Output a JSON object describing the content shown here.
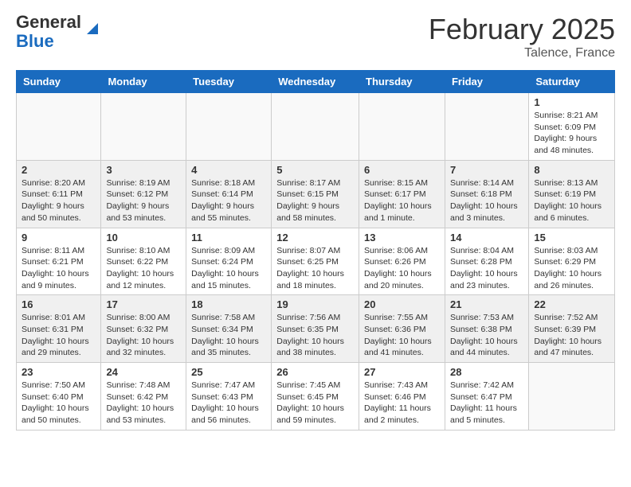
{
  "header": {
    "logo_general": "General",
    "logo_blue": "Blue",
    "month_title": "February 2025",
    "location": "Talence, France"
  },
  "weekdays": [
    "Sunday",
    "Monday",
    "Tuesday",
    "Wednesday",
    "Thursday",
    "Friday",
    "Saturday"
  ],
  "weeks": [
    [
      {
        "day": "",
        "info": ""
      },
      {
        "day": "",
        "info": ""
      },
      {
        "day": "",
        "info": ""
      },
      {
        "day": "",
        "info": ""
      },
      {
        "day": "",
        "info": ""
      },
      {
        "day": "",
        "info": ""
      },
      {
        "day": "1",
        "info": "Sunrise: 8:21 AM\nSunset: 6:09 PM\nDaylight: 9 hours and 48 minutes."
      }
    ],
    [
      {
        "day": "2",
        "info": "Sunrise: 8:20 AM\nSunset: 6:11 PM\nDaylight: 9 hours and 50 minutes."
      },
      {
        "day": "3",
        "info": "Sunrise: 8:19 AM\nSunset: 6:12 PM\nDaylight: 9 hours and 53 minutes."
      },
      {
        "day": "4",
        "info": "Sunrise: 8:18 AM\nSunset: 6:14 PM\nDaylight: 9 hours and 55 minutes."
      },
      {
        "day": "5",
        "info": "Sunrise: 8:17 AM\nSunset: 6:15 PM\nDaylight: 9 hours and 58 minutes."
      },
      {
        "day": "6",
        "info": "Sunrise: 8:15 AM\nSunset: 6:17 PM\nDaylight: 10 hours and 1 minute."
      },
      {
        "day": "7",
        "info": "Sunrise: 8:14 AM\nSunset: 6:18 PM\nDaylight: 10 hours and 3 minutes."
      },
      {
        "day": "8",
        "info": "Sunrise: 8:13 AM\nSunset: 6:19 PM\nDaylight: 10 hours and 6 minutes."
      }
    ],
    [
      {
        "day": "9",
        "info": "Sunrise: 8:11 AM\nSunset: 6:21 PM\nDaylight: 10 hours and 9 minutes."
      },
      {
        "day": "10",
        "info": "Sunrise: 8:10 AM\nSunset: 6:22 PM\nDaylight: 10 hours and 12 minutes."
      },
      {
        "day": "11",
        "info": "Sunrise: 8:09 AM\nSunset: 6:24 PM\nDaylight: 10 hours and 15 minutes."
      },
      {
        "day": "12",
        "info": "Sunrise: 8:07 AM\nSunset: 6:25 PM\nDaylight: 10 hours and 18 minutes."
      },
      {
        "day": "13",
        "info": "Sunrise: 8:06 AM\nSunset: 6:26 PM\nDaylight: 10 hours and 20 minutes."
      },
      {
        "day": "14",
        "info": "Sunrise: 8:04 AM\nSunset: 6:28 PM\nDaylight: 10 hours and 23 minutes."
      },
      {
        "day": "15",
        "info": "Sunrise: 8:03 AM\nSunset: 6:29 PM\nDaylight: 10 hours and 26 minutes."
      }
    ],
    [
      {
        "day": "16",
        "info": "Sunrise: 8:01 AM\nSunset: 6:31 PM\nDaylight: 10 hours and 29 minutes."
      },
      {
        "day": "17",
        "info": "Sunrise: 8:00 AM\nSunset: 6:32 PM\nDaylight: 10 hours and 32 minutes."
      },
      {
        "day": "18",
        "info": "Sunrise: 7:58 AM\nSunset: 6:34 PM\nDaylight: 10 hours and 35 minutes."
      },
      {
        "day": "19",
        "info": "Sunrise: 7:56 AM\nSunset: 6:35 PM\nDaylight: 10 hours and 38 minutes."
      },
      {
        "day": "20",
        "info": "Sunrise: 7:55 AM\nSunset: 6:36 PM\nDaylight: 10 hours and 41 minutes."
      },
      {
        "day": "21",
        "info": "Sunrise: 7:53 AM\nSunset: 6:38 PM\nDaylight: 10 hours and 44 minutes."
      },
      {
        "day": "22",
        "info": "Sunrise: 7:52 AM\nSunset: 6:39 PM\nDaylight: 10 hours and 47 minutes."
      }
    ],
    [
      {
        "day": "23",
        "info": "Sunrise: 7:50 AM\nSunset: 6:40 PM\nDaylight: 10 hours and 50 minutes."
      },
      {
        "day": "24",
        "info": "Sunrise: 7:48 AM\nSunset: 6:42 PM\nDaylight: 10 hours and 53 minutes."
      },
      {
        "day": "25",
        "info": "Sunrise: 7:47 AM\nSunset: 6:43 PM\nDaylight: 10 hours and 56 minutes."
      },
      {
        "day": "26",
        "info": "Sunrise: 7:45 AM\nSunset: 6:45 PM\nDaylight: 10 hours and 59 minutes."
      },
      {
        "day": "27",
        "info": "Sunrise: 7:43 AM\nSunset: 6:46 PM\nDaylight: 11 hours and 2 minutes."
      },
      {
        "day": "28",
        "info": "Sunrise: 7:42 AM\nSunset: 6:47 PM\nDaylight: 11 hours and 5 minutes."
      },
      {
        "day": "",
        "info": ""
      }
    ]
  ]
}
